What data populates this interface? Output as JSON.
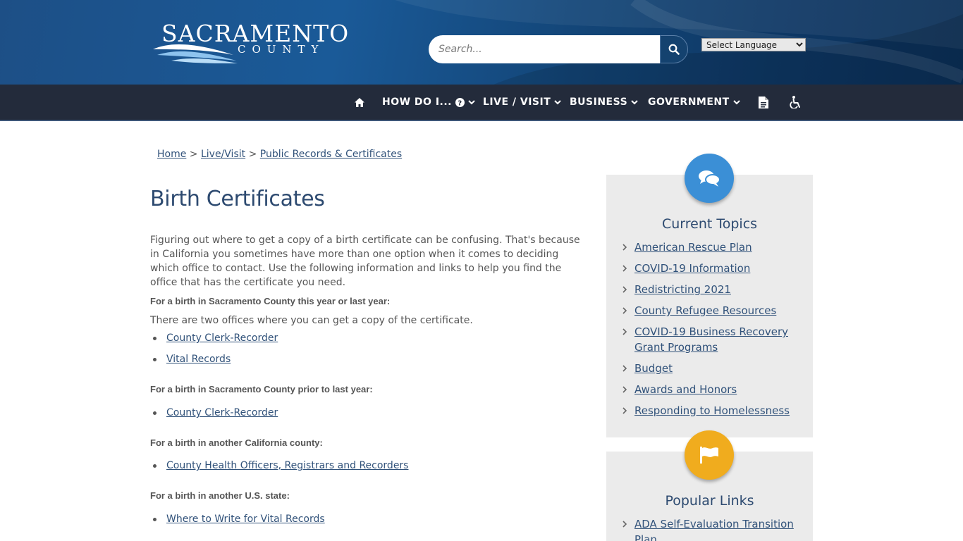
{
  "header": {
    "logo_main": "SACRAMENTO",
    "logo_sub": "COUNTY",
    "search_placeholder": "Search...",
    "language_select": "Select Language"
  },
  "nav": {
    "items": [
      {
        "label": "HOW DO I..."
      },
      {
        "label": "LIVE / VISIT"
      },
      {
        "label": "BUSINESS"
      },
      {
        "label": "GOVERNMENT"
      }
    ]
  },
  "breadcrumb": {
    "items": [
      "Home",
      "Live/Visit",
      "Public Records & Certificates"
    ],
    "separator": ">"
  },
  "page": {
    "title": "Birth Certificates",
    "intro": "Figuring out where to get a copy of a birth certificate can be confusing. That's because in California you sometimes have more than one option when it comes to deciding which office to contact. Use the following information and links to help you find the office that has the certificate you need.",
    "sections": [
      {
        "heading": "For a birth in Sacramento County this year or last year:",
        "note": "There are two offices where you can get a copy of the certificate.",
        "links": [
          "County Clerk-Recorder",
          "Vital Records"
        ]
      },
      {
        "heading": "For a birth in Sacramento County prior to last year:",
        "links": [
          "County Clerk-Recorder"
        ]
      },
      {
        "heading": "For a birth in another California county:",
        "links": [
          "County Health Officers, Registrars and Recorders"
        ]
      },
      {
        "heading": "For a birth in another U.S. state:",
        "links": [
          "Where to Write for Vital Records"
        ]
      }
    ]
  },
  "sidebar": {
    "current_topics": {
      "title": "Current Topics",
      "badge_color": "#3b8fd6",
      "links": [
        "American Rescue Plan",
        "COVID-19 Information",
        "Redistricting 2021",
        "County Refugee Resources",
        "COVID-19 Business Recovery Grant Programs",
        "Budget",
        "Awards and Honors",
        "Responding to Homelessness"
      ]
    },
    "popular_links": {
      "title": "Popular Links",
      "badge_color": "#f0ac1e",
      "links": [
        "ADA Self-Evaluation Transition Plan"
      ]
    }
  },
  "colors": {
    "header_blue": "#1a5a98",
    "nav_bg": "#232b3b",
    "link": "#31527a",
    "title": "#2d4a70"
  }
}
